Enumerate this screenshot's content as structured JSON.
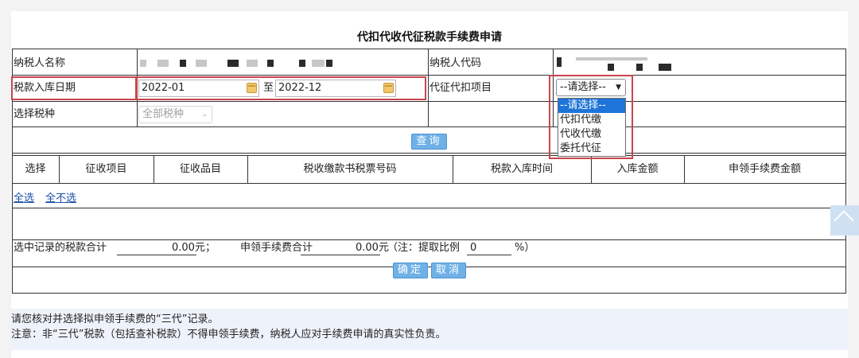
{
  "form": {
    "title": "代扣代收代征税款手续费申请",
    "taxpayer_name_label": "纳税人名称",
    "taxpayer_code_label": "纳税人代码",
    "tax_date_label": "税款入库日期",
    "date_from": "2022-01",
    "date_to_label": "至",
    "date_to": "2022-12",
    "project_label": "代征代扣项目",
    "project_select_value": "--请选择--",
    "project_options": [
      "--请选择--",
      "代扣代缴",
      "代收代缴",
      "委托代征"
    ],
    "tax_type_label": "选择税种",
    "tax_type_value": "全部税种",
    "query_button": "查询"
  },
  "table": {
    "headers": [
      "选择",
      "征收项目",
      "征收品目",
      "税收缴款书税票号码",
      "税款入库时间",
      "入库金额",
      "申领手续费金额"
    ],
    "select_all": "全选",
    "select_none": "全不选"
  },
  "summary": {
    "tax_total_label": "选中记录的税款合计",
    "tax_total_value": "0.00元；",
    "fee_total_label": "申领手续费合计",
    "fee_total_value": "0.00元",
    "ratio_prefix": "（注：提取比例",
    "ratio_value": "0",
    "ratio_suffix": "%）"
  },
  "actions": {
    "confirm": "确定",
    "cancel": "取消"
  },
  "notes": {
    "line1": "请您核对并选择拟申领手续费的“三代”记录。",
    "line2": "注意：非“三代”税款（包括查补税款）不得申领手续费，纳税人应对手续费申请的真实性负责。"
  },
  "colors": {
    "highlight_red": "#c8454c",
    "button_blue": "#6fb1e7",
    "dropdown_selected": "#1e74d8",
    "link_blue": "#1b4ea8"
  },
  "icons": {
    "calendar": "calendar-icon",
    "chevron": "chevron-down-icon",
    "back_to_top": "back-to-top-icon"
  }
}
